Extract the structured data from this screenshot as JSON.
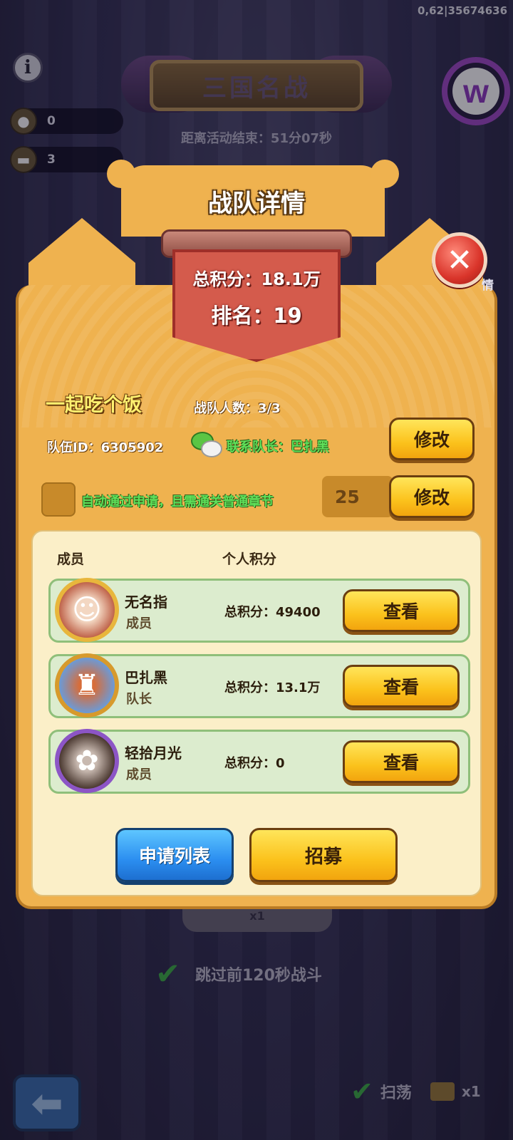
{
  "debug_text": "0,62|35674636",
  "hud": {
    "info_icon": "i",
    "resources": [
      {
        "icon": "medal-icon",
        "value": "0"
      },
      {
        "icon": "ticket-icon",
        "value": "3"
      }
    ]
  },
  "event": {
    "title": "三国名战",
    "timer": "距离活动结束：51分07秒"
  },
  "logo": {
    "letter": "w"
  },
  "modal": {
    "title": "战队详情",
    "total_score": "总积分：18.1万",
    "rank": "排名：19",
    "close_icon": "✕",
    "side_char": "情",
    "team_name": "一起吃个饭",
    "team_count": "战队人数：3/3",
    "team_id": "队伍ID：6305902",
    "contact": "联系队长：巴扎黑",
    "edit_label": "修改",
    "auto_approve_text": "自动通过申请，且需通关普通章节",
    "level_value": "25",
    "col_member": "成员",
    "col_score": "个人积分",
    "view_label": "查看",
    "members": [
      {
        "name": "无名指",
        "role": "成员",
        "score": "总积分：49400"
      },
      {
        "name": "巴扎黑",
        "role": "队长",
        "score": "总积分：13.1万"
      },
      {
        "name": "轻拾月光",
        "role": "成员",
        "score": "总积分：0"
      }
    ],
    "apply_list_label": "申请列表",
    "recruit_label": "招募"
  },
  "background": {
    "pill_text": "x1",
    "skip_text": "跳过前120秒战斗",
    "sweep_text": "扫荡",
    "sweep_count": "x1"
  },
  "colors": {
    "modal_gold": "#efb24f",
    "accent_green": "#5fe05a",
    "button_yellow": "#fbc21c",
    "button_blue": "#2b8ef0",
    "score_red": "#d45b4c"
  }
}
